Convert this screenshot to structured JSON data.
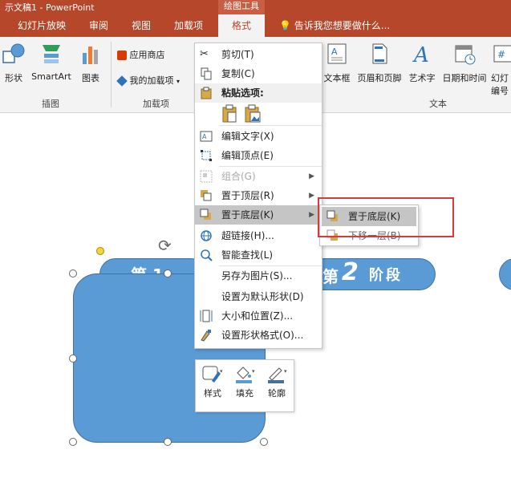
{
  "window": {
    "title": "示文稿1 - PowerPoint",
    "tool_tab_header": "绘图工具"
  },
  "tabs": [
    {
      "label": "幻灯片放映"
    },
    {
      "label": "审阅"
    },
    {
      "label": "视图"
    },
    {
      "label": "加载项"
    },
    {
      "label": "格式",
      "active": true
    }
  ],
  "tell_me": "告诉我您想要做什么...",
  "ribbon": {
    "illustrations": {
      "shapes": "形状",
      "smartart": "SmartArt",
      "chart": "图表",
      "group_label": "插图"
    },
    "addins": {
      "store": "应用商店",
      "my_addins": "我的加载项",
      "group_label": "加载项"
    },
    "text": {
      "textbox": "文本框",
      "header_footer": "页眉和页脚",
      "wordart": "艺术字",
      "datetime": "日期和时间",
      "slide_num_1": "幻灯",
      "slide_num_2": "编号",
      "group_label": "文本"
    }
  },
  "slide": {
    "banner1_text": "第 1",
    "banner2_prefix": "第",
    "banner2_num": "2",
    "banner2_suffix": "阶段"
  },
  "context_menu": {
    "items": [
      {
        "label": "剪切(T)",
        "icon": "scissors-icon"
      },
      {
        "label": "复制(C)",
        "icon": "copy-icon"
      },
      {
        "label": "粘贴选项:",
        "icon": "clipboard-icon"
      },
      {
        "label": "编辑文字(X)",
        "icon": "edit-text-icon"
      },
      {
        "label": "编辑顶点(E)",
        "icon": "edit-points-icon"
      },
      {
        "label": "组合(G)",
        "icon": "group-icon",
        "disabled": true
      },
      {
        "label": "置于顶层(R)",
        "icon": "bring-front-icon"
      },
      {
        "label": "置于底层(K)",
        "icon": "send-back-icon",
        "highlighted": true
      },
      {
        "label": "超链接(H)...",
        "icon": "hyperlink-icon"
      },
      {
        "label": "智能查找(L)",
        "icon": "smart-lookup-icon"
      },
      {
        "label": "另存为图片(S)..."
      },
      {
        "label": "设置为默认形状(D)"
      },
      {
        "label": "大小和位置(Z)...",
        "icon": "size-position-icon"
      },
      {
        "label": "设置形状格式(O)...",
        "icon": "format-shape-icon"
      }
    ]
  },
  "submenu": {
    "items": [
      {
        "label": "置于底层(K)"
      },
      {
        "label": "下移一层(B)"
      }
    ]
  },
  "mini_toolbar": {
    "style": "样式",
    "fill": "填充",
    "outline": "轮廓"
  },
  "colors": {
    "accent": "#b7472a",
    "shape_fill": "#5b9bd5",
    "highlight_box": "#d9393a"
  }
}
